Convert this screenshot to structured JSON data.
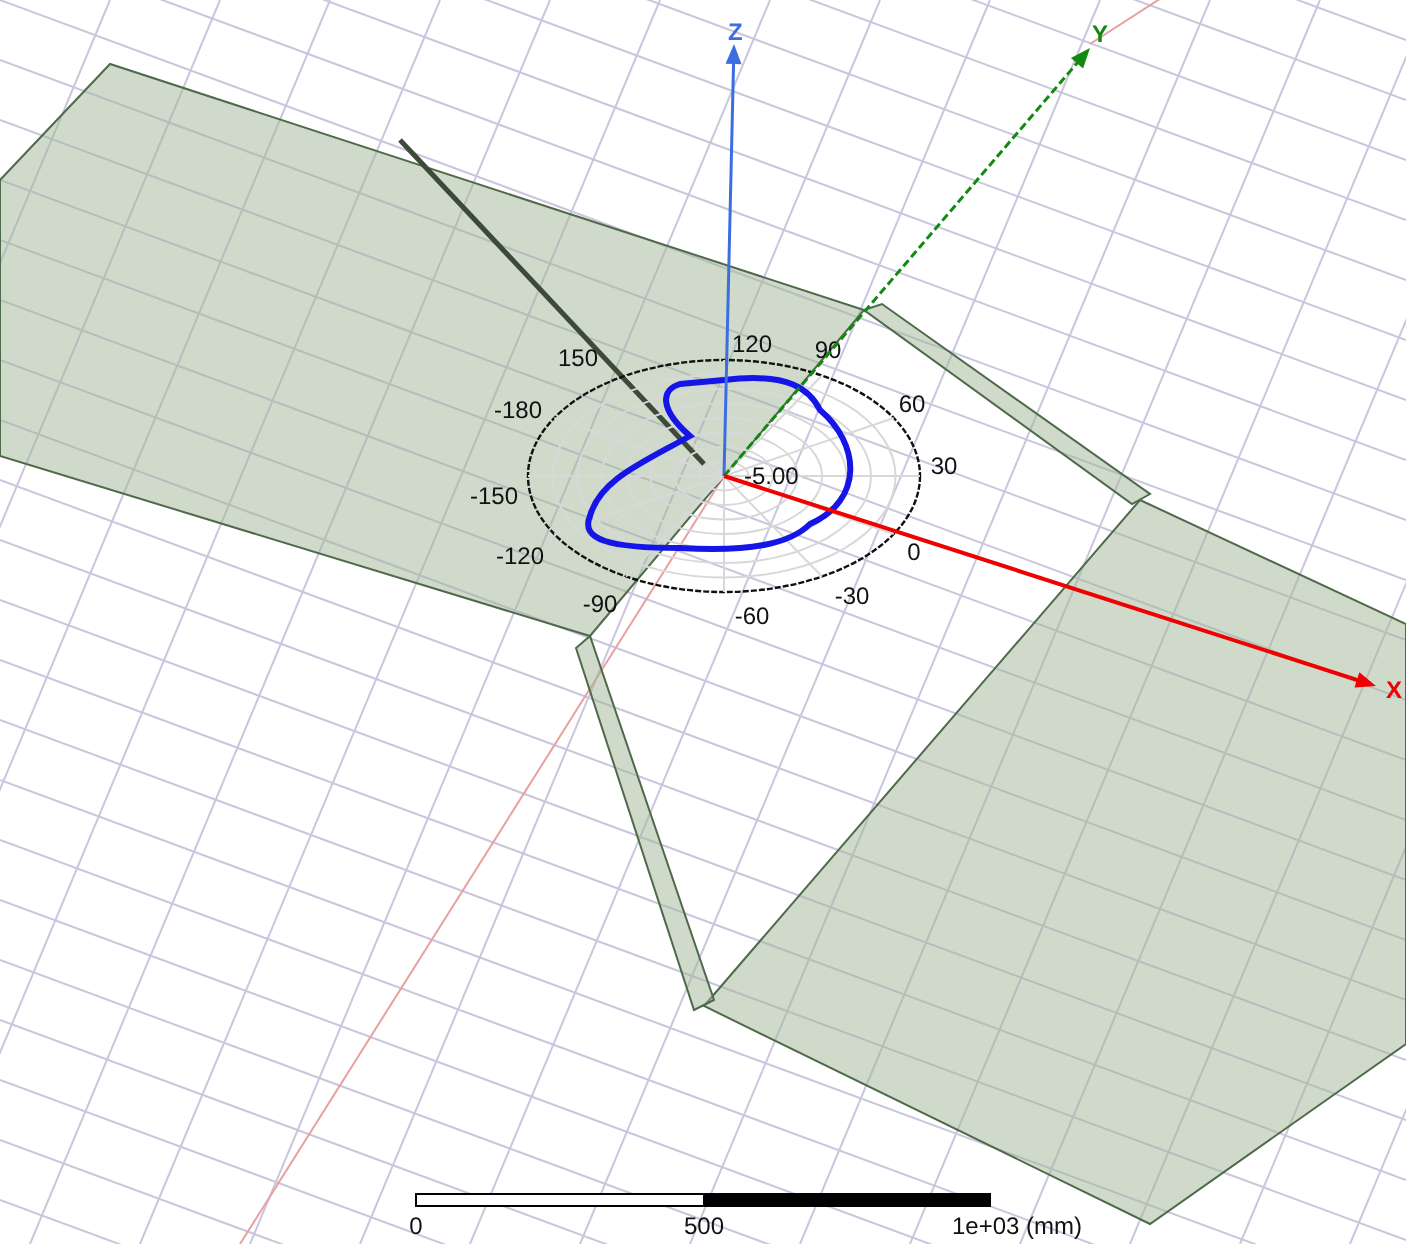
{
  "axes": [
    {
      "kind": "z",
      "label": "Z"
    },
    {
      "kind": "y",
      "label": "Y"
    },
    {
      "kind": "x",
      "label": "X"
    }
  ],
  "polar_plot": {
    "angle_labels": [
      "120",
      "90",
      "60",
      "30",
      "0",
      "-30",
      "-60",
      "-90",
      "-120",
      "-150",
      "-180",
      "150"
    ],
    "ring_label": "-5.00"
  },
  "scale_bar": {
    "labels": [
      "0",
      "500",
      "1e+03 (mm)"
    ]
  }
}
